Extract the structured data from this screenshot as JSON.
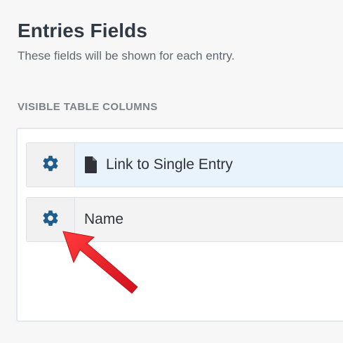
{
  "header": {
    "title": "Entries Fields",
    "subtitle": "These fields will be shown for each entry."
  },
  "section": {
    "label": "VISIBLE TABLE COLUMNS"
  },
  "columns": [
    {
      "label": "Link to Single Entry",
      "icon": "document-icon",
      "settings_icon": "gear-icon",
      "highlighted": true
    },
    {
      "label": "Name",
      "settings_icon": "gear-icon",
      "highlighted": false
    }
  ],
  "colors": {
    "gear": "#1f5d8c",
    "annotation_arrow": "#e0202c",
    "highlight_row": "#e8f3fb"
  }
}
